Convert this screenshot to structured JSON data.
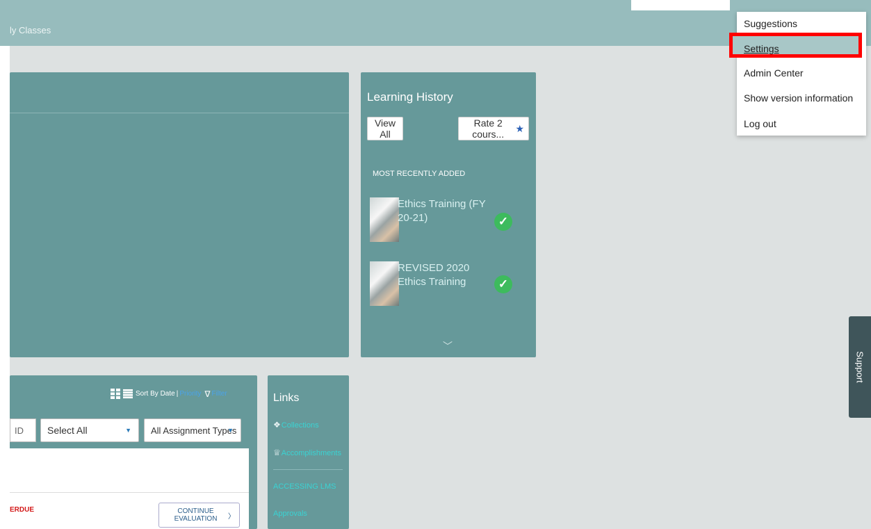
{
  "header": {
    "breadcrumb": "ly Classes"
  },
  "learning_history": {
    "title": "Learning History",
    "view_all": "View All",
    "rate": "Rate 2 cours...",
    "section_label": "MOST RECENTLY ADDED",
    "items": [
      {
        "title": "Ethics Training (FY 20-21)",
        "status": "completed"
      },
      {
        "title": "REVISED 2020 Ethics Training",
        "status": "completed"
      }
    ],
    "more_icon": "chevron-down-icon"
  },
  "assignments": {
    "sort_label": "Sort By Date",
    "sep": "|",
    "priority_label": "Priority",
    "filter_label": "Filter",
    "id_placeholder": "ID",
    "select_all": "Select All",
    "assignment_types": "All Assignment Types",
    "overdue_text": "ERDUE",
    "continue_label": "CONTINUE EVALUATION"
  },
  "links": {
    "title": "Links",
    "items": [
      {
        "label": "Collections",
        "icon": "collections-icon"
      },
      {
        "label": "Accomplishments",
        "icon": "trophy-icon"
      },
      {
        "label": "ACCESSING LMS"
      },
      {
        "label": "Approvals"
      }
    ]
  },
  "user_menu": {
    "items": [
      "Suggestions",
      "Settings",
      "Admin Center",
      "Show version information",
      "Log out"
    ],
    "highlighted": "Settings"
  },
  "support_tab": "Support",
  "colors": {
    "highlight_border": "#ff0000",
    "panel": "#66999a",
    "header": "#97bcbd"
  }
}
